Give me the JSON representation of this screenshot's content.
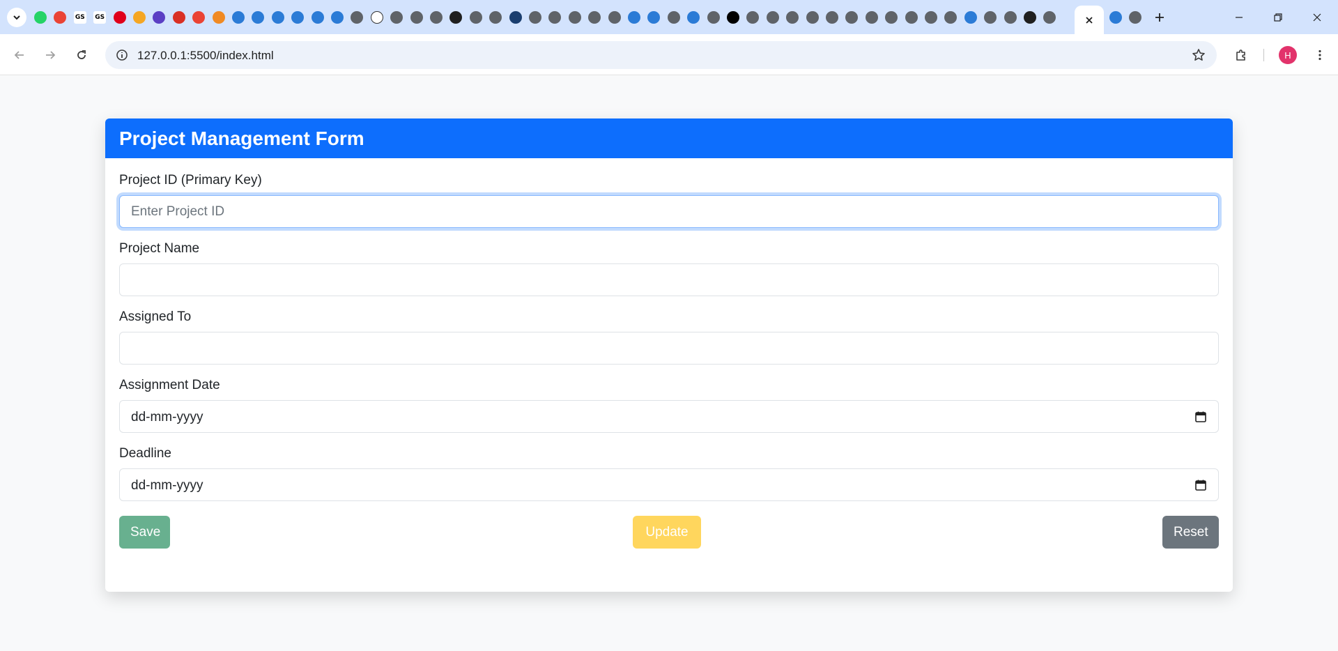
{
  "browser": {
    "url": "127.0.0.1:5500/index.html",
    "profile_initial": "H",
    "tabs": [
      {
        "icon": "whatsapp-icon",
        "color": "#25d366"
      },
      {
        "icon": "gmail-icon",
        "color": "#ea4335"
      },
      {
        "icon": "gs-icon",
        "color": "#000000",
        "text": "GS"
      },
      {
        "icon": "gs-icon",
        "color": "#000000",
        "text": "GS"
      },
      {
        "icon": "opera-icon",
        "color": "#e0001b"
      },
      {
        "icon": "avatar-icon",
        "color": "#f5a623"
      },
      {
        "icon": "list-icon",
        "color": "#5b3fc4"
      },
      {
        "icon": "calendar-icon",
        "color": "#d93025"
      },
      {
        "icon": "gmail-icon",
        "color": "#ea4335"
      },
      {
        "icon": "mn-icon",
        "color": "#f08a24"
      },
      {
        "icon": "cube-icon",
        "color": "#2b7bd6"
      },
      {
        "icon": "cube-icon",
        "color": "#2b7bd6"
      },
      {
        "icon": "cube-icon",
        "color": "#2b7bd6"
      },
      {
        "icon": "cube-icon",
        "color": "#2b7bd6"
      },
      {
        "icon": "cube-icon",
        "color": "#2b7bd6"
      },
      {
        "icon": "cube-icon",
        "color": "#2b7bd6"
      },
      {
        "icon": "chrome-icon",
        "color": "#5f6368"
      },
      {
        "icon": "openai-icon",
        "color": "#ffffff"
      },
      {
        "icon": "globe-icon",
        "color": "#5f6368"
      },
      {
        "icon": "globe-icon",
        "color": "#5f6368"
      },
      {
        "icon": "globe-icon",
        "color": "#5f6368"
      },
      {
        "icon": "github-icon",
        "color": "#1f1f1f"
      },
      {
        "icon": "globe-icon",
        "color": "#5f6368"
      },
      {
        "icon": "chrome-icon",
        "color": "#5f6368"
      },
      {
        "icon": "check-icon",
        "color": "#1a3e6f"
      },
      {
        "icon": "globe-icon",
        "color": "#5f6368"
      },
      {
        "icon": "globe-icon",
        "color": "#5f6368"
      },
      {
        "icon": "globe-icon",
        "color": "#5f6368"
      },
      {
        "icon": "chrome-icon",
        "color": "#5f6368"
      },
      {
        "icon": "globe-icon",
        "color": "#5f6368"
      },
      {
        "icon": "cube-icon",
        "color": "#2b7bd6"
      },
      {
        "icon": "cube-icon",
        "color": "#2b7bd6"
      },
      {
        "icon": "globe-icon",
        "color": "#5f6368"
      },
      {
        "icon": "cube-icon",
        "color": "#2b7bd6"
      },
      {
        "icon": "globe-icon",
        "color": "#5f6368"
      },
      {
        "icon": "openai-icon",
        "color": "#000000"
      },
      {
        "icon": "globe-icon",
        "color": "#5f6368"
      },
      {
        "icon": "globe-icon",
        "color": "#5f6368"
      },
      {
        "icon": "globe-icon",
        "color": "#5f6368"
      },
      {
        "icon": "globe-icon",
        "color": "#5f6368"
      },
      {
        "icon": "globe-icon",
        "color": "#5f6368"
      },
      {
        "icon": "globe-icon",
        "color": "#5f6368"
      },
      {
        "icon": "globe-icon",
        "color": "#5f6368"
      },
      {
        "icon": "chrome-icon",
        "color": "#5f6368"
      },
      {
        "icon": "globe-icon",
        "color": "#5f6368"
      },
      {
        "icon": "globe-icon",
        "color": "#5f6368"
      },
      {
        "icon": "globe-icon",
        "color": "#5f6368"
      },
      {
        "icon": "cube-icon",
        "color": "#2b7bd6"
      },
      {
        "icon": "globe-icon",
        "color": "#5f6368"
      },
      {
        "icon": "globe-icon",
        "color": "#5f6368"
      },
      {
        "icon": "github-icon",
        "color": "#1f1f1f"
      },
      {
        "icon": "globe-icon",
        "color": "#5f6368"
      }
    ],
    "after_active_tabs": [
      {
        "icon": "cube-icon",
        "color": "#2b7bd6"
      },
      {
        "icon": "globe-icon",
        "color": "#5f6368"
      }
    ]
  },
  "form": {
    "title": "Project Management Form",
    "fields": [
      {
        "label": "Project ID (Primary Key)",
        "placeholder": "Enter Project ID",
        "value": ""
      },
      {
        "label": "Project Name",
        "placeholder": "",
        "value": ""
      },
      {
        "label": "Assigned To",
        "placeholder": "",
        "value": ""
      }
    ],
    "date_fields": [
      {
        "label": "Assignment Date",
        "display": "dd-mm-yyyy"
      },
      {
        "label": "Deadline",
        "display": "dd-mm-yyyy"
      }
    ],
    "buttons": {
      "save": "Save",
      "update": "Update",
      "reset": "Reset"
    }
  },
  "colors": {
    "primary": "#0d6efd",
    "success": "#198754",
    "warning": "#ffc107",
    "secondary": "#6c757d",
    "tab_strip": "#d3e3fd"
  }
}
